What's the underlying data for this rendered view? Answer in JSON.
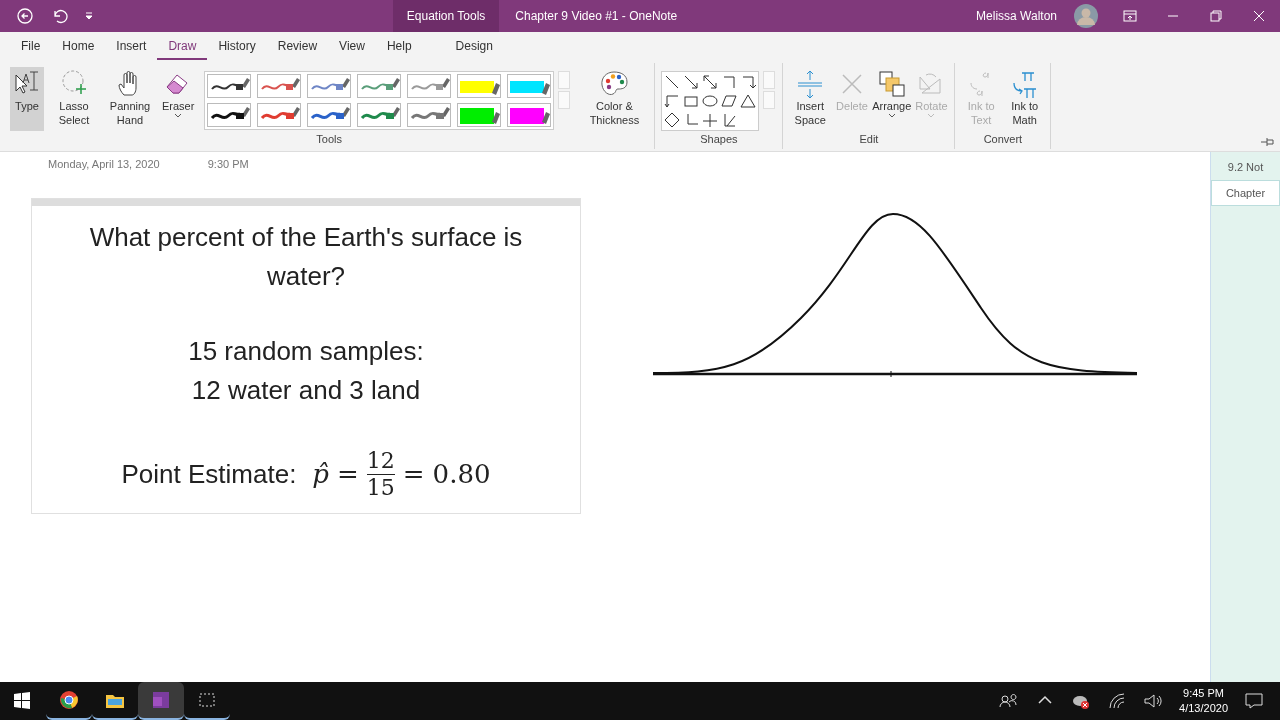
{
  "title_bar": {
    "context_tab": "Equation Tools",
    "title": "Chapter 9 Video #1  -  OneNote",
    "user": "Melissa Walton"
  },
  "ribbon_tabs": [
    {
      "label": "File",
      "selected": false
    },
    {
      "label": "Home",
      "selected": false
    },
    {
      "label": "Insert",
      "selected": false
    },
    {
      "label": "Draw",
      "selected": true
    },
    {
      "label": "History",
      "selected": false
    },
    {
      "label": "Review",
      "selected": false
    },
    {
      "label": "View",
      "selected": false
    },
    {
      "label": "Help",
      "selected": false
    },
    {
      "label": "Design",
      "selected": false
    }
  ],
  "tools_group": {
    "label": "Tools",
    "buttons": [
      {
        "kind": "type",
        "label": "Type",
        "selected": true
      },
      {
        "kind": "lasso",
        "label": "Lasso Select",
        "selected": false
      },
      {
        "kind": "hand",
        "label": "Panning Hand",
        "selected": false
      },
      {
        "kind": "eraser",
        "label": "Eraser",
        "selected": false
      }
    ],
    "pens": [
      {
        "kind": "pen",
        "color": "#333333",
        "thick": false
      },
      {
        "kind": "pen",
        "color": "#d9534f",
        "thick": false
      },
      {
        "kind": "pen",
        "color": "#6f86c6",
        "thick": false
      },
      {
        "kind": "pen",
        "color": "#5a9e7a",
        "thick": false
      },
      {
        "kind": "pen",
        "color": "#9a9a9a",
        "thick": false
      },
      {
        "kind": "highlighter",
        "color": "#ffff00",
        "thick": false
      },
      {
        "kind": "highlighter",
        "color": "#00e5ff",
        "thick": false
      },
      {
        "kind": "pen",
        "color": "#111111",
        "thick": true
      },
      {
        "kind": "pen",
        "color": "#e03c31",
        "thick": true
      },
      {
        "kind": "pen",
        "color": "#2a62c9",
        "thick": true
      },
      {
        "kind": "pen",
        "color": "#1f8a4c",
        "thick": true
      },
      {
        "kind": "pen",
        "color": "#777777",
        "thick": true
      },
      {
        "kind": "highlighter",
        "color": "#00ee00",
        "thick": true
      },
      {
        "kind": "highlighter",
        "color": "#ff00ff",
        "thick": true
      }
    ],
    "color_button": "Color & Thickness"
  },
  "shapes_group": {
    "label": "Shapes"
  },
  "edit_group": {
    "label": "Edit",
    "buttons": [
      {
        "kind": "insert-space",
        "label": "Insert Space",
        "disabled": false,
        "dropdown": false
      },
      {
        "kind": "delete",
        "label": "Delete",
        "disabled": true,
        "dropdown": false
      },
      {
        "kind": "arrange",
        "label": "Arrange",
        "disabled": false,
        "dropdown": true
      },
      {
        "kind": "rotate",
        "label": "Rotate",
        "disabled": true,
        "dropdown": true
      }
    ]
  },
  "convert_group": {
    "label": "Convert",
    "buttons": [
      {
        "kind": "ink-text",
        "label": "Ink to Text",
        "disabled": true
      },
      {
        "kind": "ink-math",
        "label": "Ink to Math",
        "disabled": false
      }
    ]
  },
  "page": {
    "date": "Monday, April 13, 2020",
    "time": "9:30 PM",
    "note": {
      "question": "What percent of the Earth's surface is water?",
      "lines": [
        "15 random samples:",
        "12 water and 3 land"
      ],
      "equation": {
        "label": "Point Estimate:",
        "symbol": "p̂",
        "equals": "=",
        "numerator": "12",
        "denominator": "15",
        "equals_2": "=",
        "result": "0.80"
      }
    }
  },
  "page_list": [
    {
      "label": "9.2 Not",
      "selected": false
    },
    {
      "label": "Chapter",
      "selected": true
    }
  ],
  "taskbar": {
    "time": "9:45 PM",
    "date": "4/13/2020"
  }
}
